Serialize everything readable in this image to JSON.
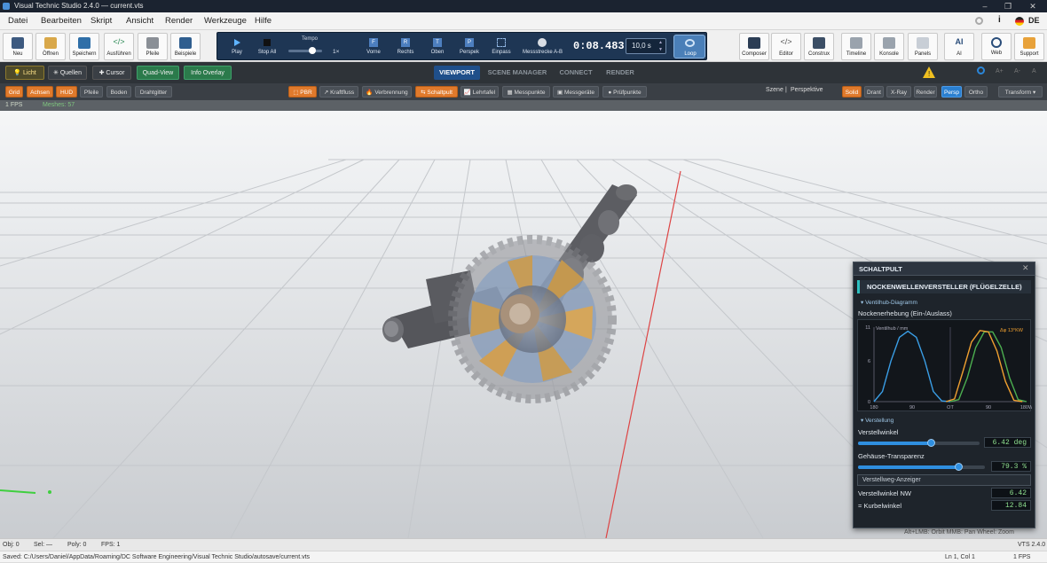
{
  "window": {
    "title": "Visual Technic Studio 2.4.0 — current.vts"
  },
  "menu": [
    "Datei",
    "Bearbeiten",
    "Skript",
    "Ansicht",
    "Render",
    "Werkzeuge",
    "Hilfe"
  ],
  "menu_right": {
    "lang": "DE"
  },
  "toolbar": {
    "left": [
      "Neu",
      "Öffnen",
      "Speichern",
      "Ausführen",
      "Pfeile",
      "Beispiele"
    ],
    "right": [
      "Composer",
      "Editor",
      "Construx",
      "Timeline",
      "Konsole",
      "Panels",
      "AI",
      "Web",
      "Support"
    ],
    "ai_glyph": "AI"
  },
  "transport": {
    "play": "Play",
    "stop": "Stop All",
    "tempo_label": "Tempo",
    "tempo_value": "1×",
    "views": [
      "Vorne",
      "Rechts",
      "Oben",
      "Perspek",
      "Einpass",
      "Messstrecke A-B"
    ],
    "view_glyphs": [
      "F",
      "R",
      "T",
      "P"
    ],
    "time": "0:08.483",
    "duration": "10,0 s",
    "loop": "Loop"
  },
  "bar3": {
    "licht": "Licht",
    "quellen": "Quellen",
    "cursor": "Cursor",
    "quadview": "Quad-View",
    "overlay": "Info Overlay",
    "tabs": [
      "VIEWPORT",
      "SCENE MANAGER",
      "CONNECT",
      "RENDER"
    ],
    "zoom_labels": [
      "A+",
      "A-",
      "A"
    ]
  },
  "bar4": {
    "left": [
      "Grid",
      "Achsen",
      "HUD",
      "Pfeile",
      "Boden",
      "Drahtgitter"
    ],
    "middle": [
      "PBR",
      "Kraftfluss",
      "Verbrennung",
      "Schaltpult",
      "Lehrtafel",
      "Messpunkte",
      "Messgeräte",
      "Prüfpunkte"
    ],
    "scene": "Szene",
    "persp": "Perspektive",
    "render_modes": [
      "Solid",
      "Drant",
      "X-Ray",
      "Render",
      "Persp",
      "Ortho"
    ],
    "transform": "Transform ▾"
  },
  "info": {
    "fps": "1 FPS",
    "meshes": "Meshes: 57"
  },
  "panel": {
    "title": "SCHALTPULT",
    "header": "NOCKENWELLENVERSTELLER (FLÜGELZELLE)",
    "sec1": "▾ Ventilhub-Diagramm",
    "chart_title": "Nockenerhebung (Ein-/Auslass)",
    "sec2": "▾ Verstellung",
    "slider1_label": "Verstellwinkel",
    "slider1_value": "6.42 deg",
    "slider2_label": "Gehäuse-Transparenz",
    "slider2_value": "79.3 %",
    "section_box": "Verstellweg-Anzeiger",
    "row1_label": "Verstellwinkel NW",
    "row1_value": "6.42",
    "row2_label": "= Kurbelwinkel",
    "row2_value": "12.84",
    "slider1_fraction": 0.6,
    "slider2_fraction": 0.793
  },
  "chart_data": {
    "type": "line",
    "title": "Nockenerhebung (Ein-/Auslass)",
    "ylabel": "Ventilhub / mm",
    "xlabel": "",
    "xticks": [
      "180",
      "90",
      "OT",
      "90",
      "180W"
    ],
    "yticks": [
      "0",
      "6",
      "11"
    ],
    "ylim": [
      0,
      11
    ],
    "annotation": "Δφ 13°KW",
    "grid": false,
    "series": [
      {
        "color": "#3a9ee6",
        "x": [
          180,
          160,
          140,
          120,
          100,
          80,
          60,
          40,
          20,
          0
        ],
        "y": [
          0,
          1.5,
          6,
          9.5,
          10.4,
          9.5,
          6,
          1.5,
          0.1,
          0
        ]
      },
      {
        "color": "#4caf50",
        "x": [
          0,
          20,
          40,
          60,
          80,
          100,
          120,
          140,
          160,
          180
        ],
        "y": [
          0,
          0.3,
          3.5,
          8,
          10.3,
          10.3,
          8,
          3.5,
          0.3,
          0
        ]
      },
      {
        "color": "#f0a030",
        "x": [
          -10,
          10,
          30,
          50,
          70,
          90,
          110,
          130,
          150,
          170
        ],
        "y": [
          0,
          0.4,
          4.5,
          8.8,
          10.5,
          10.3,
          7.5,
          3,
          0.2,
          0
        ]
      }
    ],
    "colors": {
      "blue": "#3a9ee6",
      "green": "#4caf50",
      "orange": "#f0a030"
    }
  },
  "statusbar": {
    "obj": "Obj: 0",
    "sel": "Sel: —",
    "poly": "Poly: 0",
    "fps": "FPS: 1",
    "hint": "Alt+LMB: Orbit    MMB: Pan    Wheel: Zoom",
    "version": "VTS 2.4.0"
  },
  "pathbar": {
    "path": "Saved: C:/Users/Daniel/AppData/Roaming/DC Software Engineering/Visual Technic Studio/autosave/current.vts",
    "pos": "Ln 1, Col 1",
    "fps": "1 FPS"
  }
}
